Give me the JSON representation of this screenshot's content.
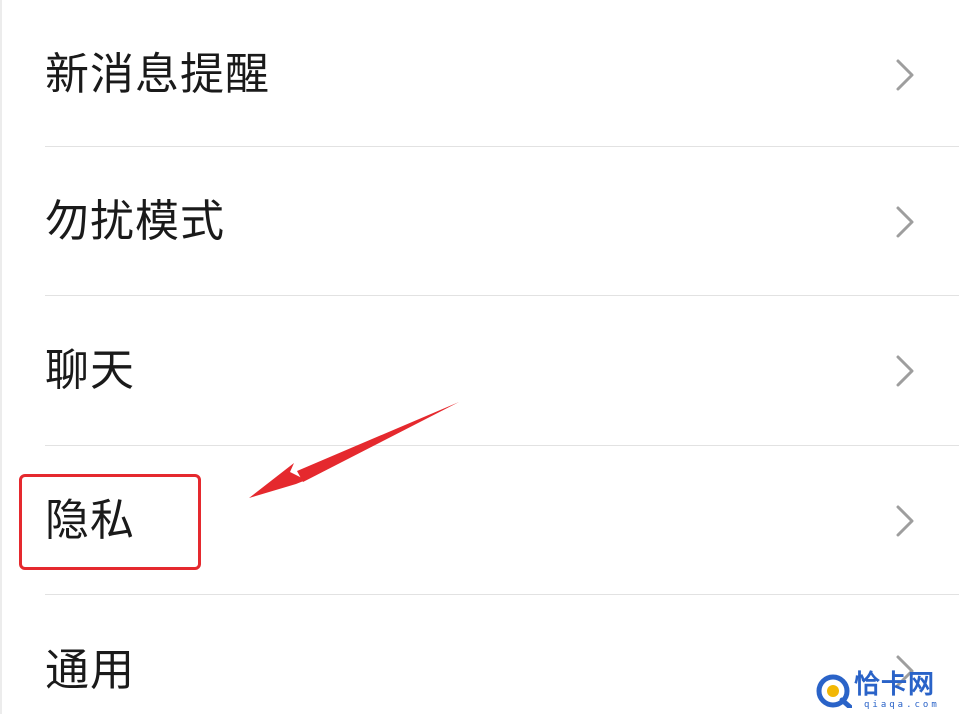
{
  "settings": {
    "items": [
      {
        "label": "新消息提醒",
        "icon": "chevron-right-icon"
      },
      {
        "label": "勿扰模式",
        "icon": "chevron-right-icon"
      },
      {
        "label": "聊天",
        "icon": "chevron-right-icon"
      },
      {
        "label": "隐私",
        "icon": "chevron-right-icon"
      },
      {
        "label": "通用",
        "icon": "chevron-right-icon"
      }
    ]
  },
  "annotation": {
    "highlight_color": "#e5292e",
    "target": "隐私"
  },
  "watermark": {
    "text": "恰卡网",
    "subtext": "qiaqa.com",
    "color": "#2a63c8"
  }
}
